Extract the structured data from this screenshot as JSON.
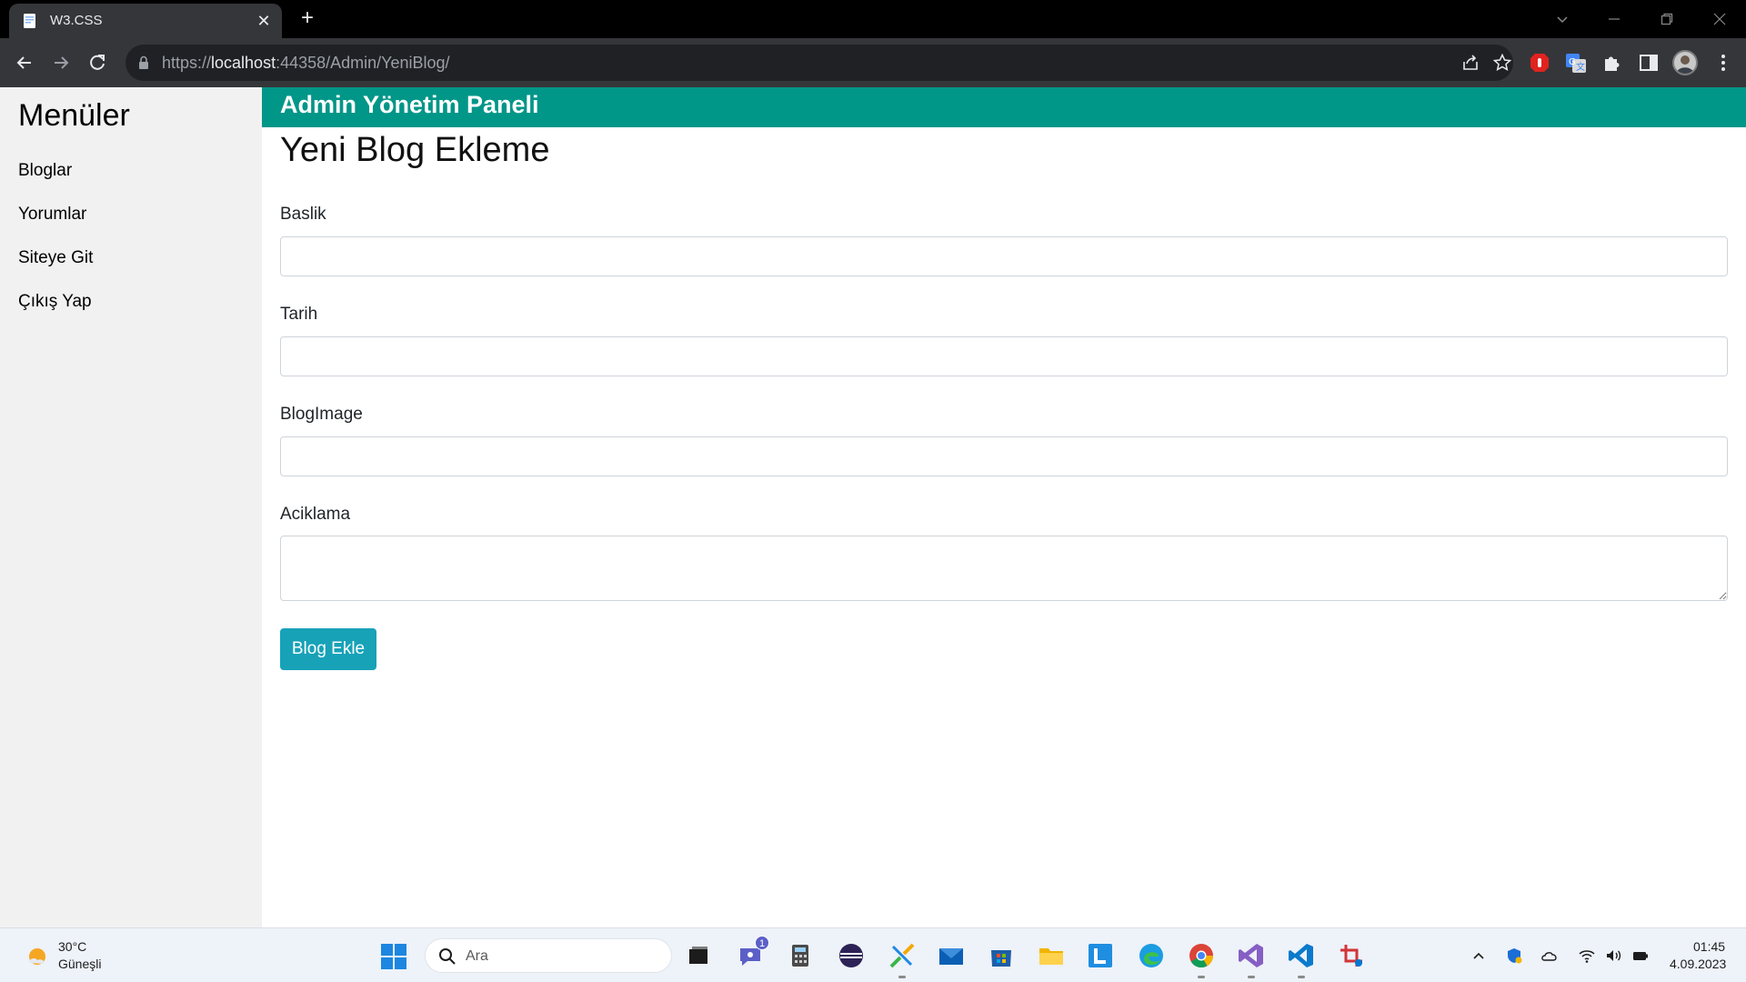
{
  "browser": {
    "tab_title": "W3.CSS",
    "url_scheme": "https://",
    "url_host": "localhost",
    "url_rest": ":44358/Admin/YeniBlog/"
  },
  "sidebar": {
    "title": "Menüler",
    "items": [
      {
        "label": "Bloglar"
      },
      {
        "label": "Yorumlar"
      },
      {
        "label": "Siteye Git"
      },
      {
        "label": "Çıkış Yap"
      }
    ]
  },
  "header": {
    "title": "Admin Yönetim Paneli"
  },
  "form": {
    "title": "Yeni Blog Ekleme",
    "fields": [
      {
        "label": "Baslik",
        "value": ""
      },
      {
        "label": "Tarih",
        "value": ""
      },
      {
        "label": "BlogImage",
        "value": ""
      },
      {
        "label": "Aciklama",
        "value": ""
      }
    ],
    "submit_label": "Blog Ekle"
  },
  "taskbar": {
    "weather_temp": "30°C",
    "weather_desc": "Güneşli",
    "search_placeholder": "Ara",
    "teams_badge": "1",
    "clock_time": "01:45",
    "clock_date": "4.09.2023"
  },
  "colors": {
    "header_bg": "#009688",
    "button_bg": "#17a2b8",
    "sidebar_bg": "#f1f1f1"
  }
}
